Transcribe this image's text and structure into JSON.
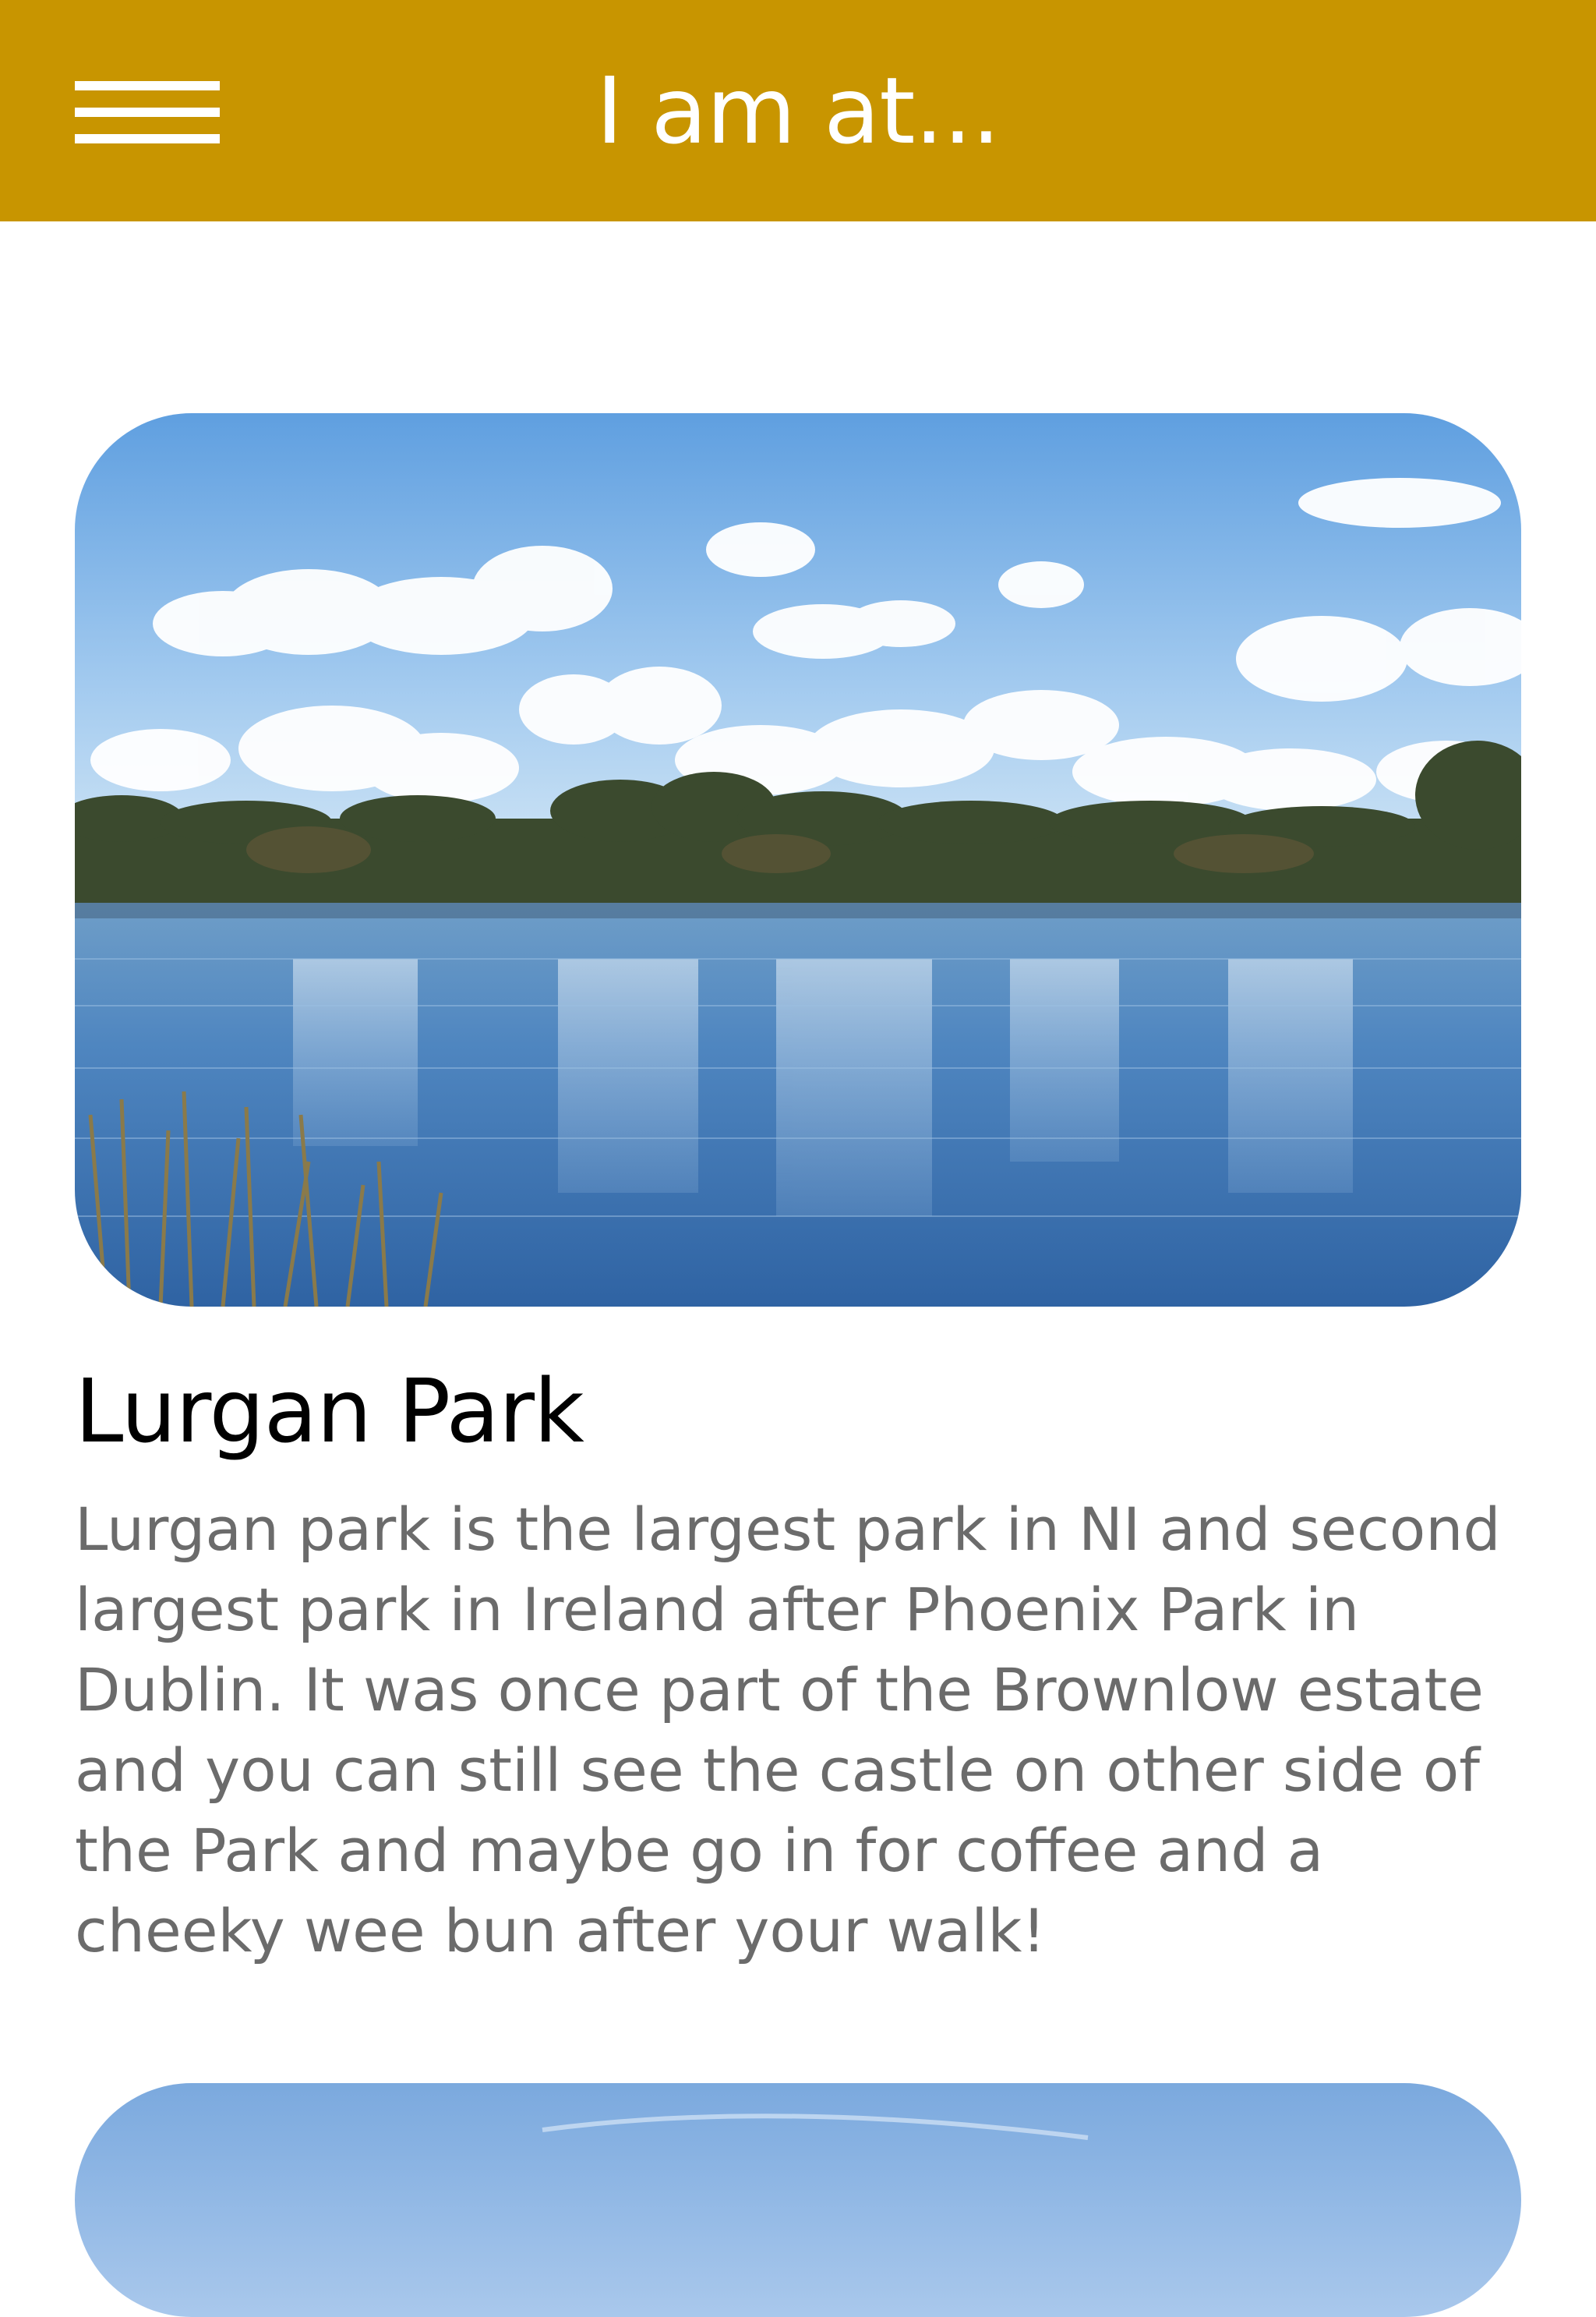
{
  "app_bar": {
    "title": "I am at...",
    "background_color": "#C89500",
    "menu_icon": "hamburger-menu-icon"
  },
  "places": [
    {
      "name": "Lurgan Park",
      "description": "Lurgan park is the largest park in NI and second largest park in Ireland after Phoenix Park in Dublin. It was once part of the Brownlow estate and you can still see the castle on other side of the Park and maybe go in for coffee and a cheeky wee bun after your walk!",
      "image": "lake-landscape-photo"
    }
  ]
}
